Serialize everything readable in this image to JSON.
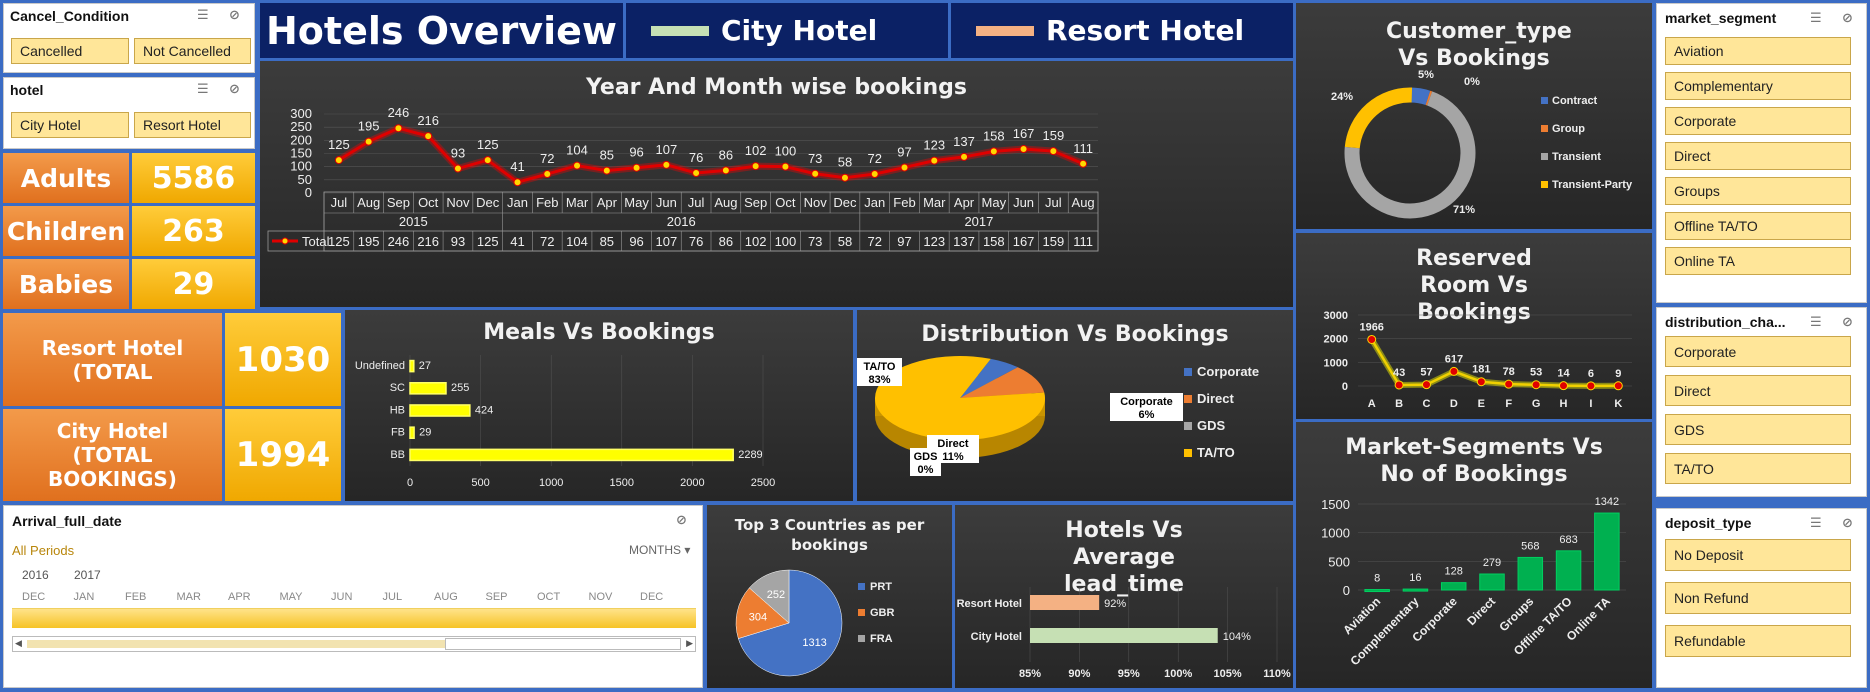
{
  "header": {
    "title": "Hotels Overview",
    "legend_city": "City Hotel",
    "legend_resort": "Resort Hotel",
    "city_color": "#c6e0b4",
    "resort_color": "#f4b183"
  },
  "slicers": {
    "cancel": {
      "title": "Cancel_Condition",
      "items": [
        "Cancelled",
        "Not Cancelled"
      ]
    },
    "hotel": {
      "title": "hotel",
      "items": [
        "City Hotel",
        "Resort Hotel"
      ]
    },
    "market": {
      "title": "market_segment",
      "items": [
        "Aviation",
        "Complementary",
        "Corporate",
        "Direct",
        "Groups",
        "Offline TA/TO",
        "Online TA"
      ]
    },
    "distribution": {
      "title": "distribution_cha...",
      "items": [
        "Corporate",
        "Direct",
        "GDS",
        "TA/TO"
      ]
    },
    "deposit": {
      "title": "deposit_type",
      "items": [
        "No Deposit",
        "Non Refund",
        "Refundable"
      ]
    }
  },
  "kpis": {
    "adults_label": "Adults",
    "adults": "5586",
    "children_label": "Children",
    "children": "263",
    "babies_label": "Babies",
    "babies": "29",
    "resort_label": "Resort Hotel (TOTAL",
    "resort_value": "1030",
    "city_label": "City Hotel (TOTAL BOOKINGS)",
    "city_value": "1994"
  },
  "timeline": {
    "title": "Arrival_full_date",
    "all_periods": "All Periods",
    "level": "MONTHS",
    "years": [
      "2016",
      "2017"
    ],
    "months": [
      "DEC",
      "JAN",
      "FEB",
      "MAR",
      "APR",
      "MAY",
      "JUN",
      "JUL",
      "AUG",
      "SEP",
      "OCT",
      "NOV",
      "DEC"
    ]
  },
  "titles": {
    "line": "Year And Month wise bookings",
    "meals": "Meals Vs Bookings",
    "dist": "Distribution Vs Bookings",
    "cust": "Customer_type Vs Bookings",
    "room": "Reserved Room Vs Bookings",
    "market": "Market-Segments Vs No of Bookings",
    "countries": "Top 3 Countries as per bookings",
    "lead": "Hotels Vs Average lead_time"
  },
  "chart_data": [
    {
      "type": "line",
      "title": "Year And Month wise bookings",
      "series_name": "Total",
      "ylim": [
        0,
        300
      ],
      "yticks": [
        0,
        50,
        100,
        150,
        200,
        250,
        300
      ],
      "years": [
        {
          "label": "2015",
          "count": 6
        },
        {
          "label": "2016",
          "count": 12
        },
        {
          "label": "2017",
          "count": 8
        }
      ],
      "x": [
        "Jul",
        "Aug",
        "Sep",
        "Oct",
        "Nov",
        "Dec",
        "Jan",
        "Feb",
        "Mar",
        "Apr",
        "May",
        "Jun",
        "Jul",
        "Aug",
        "Sep",
        "Oct",
        "Nov",
        "Dec",
        "Jan",
        "Feb",
        "Mar",
        "Apr",
        "May",
        "Jun",
        "Jul",
        "Aug"
      ],
      "values": [
        125,
        195,
        246,
        216,
        93,
        125,
        41,
        72,
        104,
        85,
        96,
        107,
        76,
        86,
        102,
        100,
        73,
        58,
        72,
        97,
        123,
        137,
        158,
        167,
        159,
        111
      ]
    },
    {
      "type": "bar",
      "title": "Meals Vs Bookings",
      "orientation": "horizontal",
      "categories": [
        "Undefined",
        "SC",
        "HB",
        "FB",
        "BB"
      ],
      "values": [
        27,
        255,
        424,
        29,
        2289
      ],
      "xlim": [
        0,
        2500
      ],
      "xticks": [
        0,
        500,
        1000,
        1500,
        2000,
        2500
      ]
    },
    {
      "type": "pie",
      "title": "Distribution Vs Bookings",
      "categories": [
        "Corporate",
        "Direct",
        "GDS",
        "TA/TO"
      ],
      "values": [
        6,
        11,
        0,
        83
      ],
      "labels": [
        "Corporate 6%",
        "Direct 11%",
        "GDS 0%",
        "TA/TO 83%"
      ],
      "colors": [
        "#4472c4",
        "#ed7d31",
        "#a5a5a5",
        "#ffc000"
      ]
    },
    {
      "type": "pie",
      "title": "Customer_type Vs Bookings",
      "categories": [
        "Contract",
        "Group",
        "Transient",
        "Transient-Party"
      ],
      "values": [
        5,
        0,
        71,
        24
      ],
      "labels": [
        "5%",
        "0%",
        "71%",
        "24%"
      ],
      "colors": [
        "#4472c4",
        "#ed7d31",
        "#a5a5a5",
        "#ffc000"
      ]
    },
    {
      "type": "line",
      "title": "Reserved Room Vs Bookings",
      "x": [
        "A",
        "B",
        "C",
        "D",
        "E",
        "F",
        "G",
        "H",
        "I",
        "K"
      ],
      "values": [
        1966,
        43,
        57,
        617,
        181,
        78,
        53,
        14,
        6,
        9
      ],
      "ylim": [
        0,
        3000
      ],
      "yticks": [
        0,
        1000,
        2000,
        3000
      ]
    },
    {
      "type": "bar",
      "title": "Market-Segments Vs No of Bookings",
      "categories": [
        "Aviation",
        "Complementary",
        "Corporate",
        "Direct",
        "Groups",
        "Offline TA/TO",
        "Online TA"
      ],
      "values": [
        8,
        16,
        128,
        279,
        568,
        683,
        1342
      ],
      "ylim": [
        0,
        1500
      ],
      "yticks": [
        0,
        500,
        1000,
        1500
      ]
    },
    {
      "type": "pie",
      "title": "Top 3 Countries as per bookings",
      "categories": [
        "PRT",
        "GBR",
        "FRA"
      ],
      "values": [
        1313,
        304,
        252
      ],
      "colors": [
        "#4472c4",
        "#ed7d31",
        "#a5a5a5"
      ]
    },
    {
      "type": "bar",
      "title": "Hotels Vs Average lead_time",
      "orientation": "horizontal",
      "categories": [
        "Resort Hotel",
        "City Hotel"
      ],
      "values": [
        92,
        104
      ],
      "labels": [
        "92%",
        "104%"
      ],
      "xlim": [
        85,
        110
      ],
      "xticks": [
        "85%",
        "90%",
        "95%",
        "100%",
        "105%",
        "110%"
      ],
      "colors": [
        "#f4b183",
        "#c6e0b4"
      ]
    }
  ]
}
